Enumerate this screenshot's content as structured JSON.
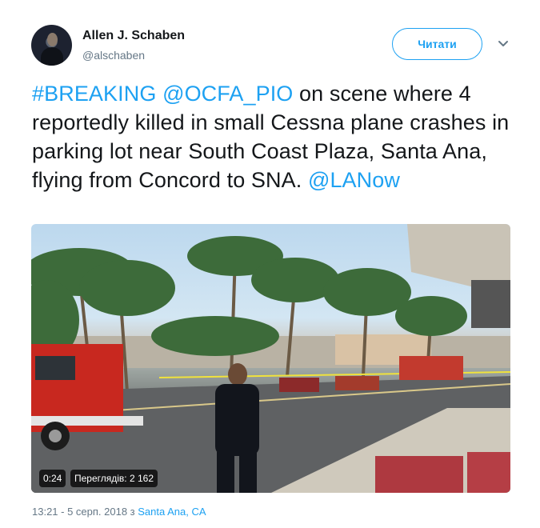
{
  "author": {
    "name": "Allen J. Schaben",
    "handle": "@alschaben",
    "avatar_icon": "profile-photo"
  },
  "follow_button": {
    "label": "Читати"
  },
  "menu_icon": "chevron-down-icon",
  "tweet": {
    "text_parts": [
      {
        "text": "#BREAKING",
        "link": true
      },
      {
        "text": " ",
        "link": false
      },
      {
        "text": "@OCFA_PIO",
        "link": true
      },
      {
        "text": " on scene where 4 reportedly killed in small Cessna plane crashes in parking lot near South Coast Plaza, Santa Ana,  flying from Concord to SNA. ",
        "link": false
      },
      {
        "text": "@LANow",
        "link": true
      }
    ]
  },
  "media": {
    "type": "video",
    "duration": "0:24",
    "views": "Переглядів: 2 162"
  },
  "meta": {
    "timestamp": "13:21 - 5 серп. 2018 з ",
    "location": "Santa Ana, CA"
  },
  "colors": {
    "accent": "#1da1f2",
    "secondary": "#657786",
    "text": "#14171a"
  }
}
